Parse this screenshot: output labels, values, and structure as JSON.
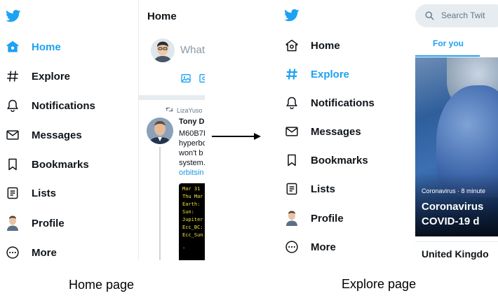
{
  "home_page": {
    "nav": {
      "items": [
        {
          "label": "Home",
          "icon": "home-icon",
          "active": true
        },
        {
          "label": "Explore",
          "icon": "hashtag-icon",
          "active": false
        },
        {
          "label": "Notifications",
          "icon": "bell-icon",
          "active": false
        },
        {
          "label": "Messages",
          "icon": "envelope-icon",
          "active": false
        },
        {
          "label": "Bookmarks",
          "icon": "bookmark-icon",
          "active": false
        },
        {
          "label": "Lists",
          "icon": "list-icon",
          "active": false
        },
        {
          "label": "Profile",
          "icon": "profile-avatar",
          "active": false
        },
        {
          "label": "More",
          "icon": "more-icon",
          "active": false
        }
      ]
    },
    "header_title": "Home",
    "compose_placeholder": "What",
    "retweet_by": "LizaYuso",
    "tweet": {
      "author": "Tony D",
      "lines": [
        "M60B7I",
        "hyperbo",
        "won't b",
        "system."
      ],
      "link": "orbitsin",
      "terminal_lines": [
        "Mar 31",
        "Thu Mar",
        "Earth:",
        "Sun:",
        "Jupiter",
        "Ecc_BC:",
        "Ecc_Sun",
        "."
      ]
    },
    "caption": "Home page"
  },
  "explore_page": {
    "nav": {
      "items": [
        {
          "label": "Home",
          "icon": "home-icon",
          "active": false
        },
        {
          "label": "Explore",
          "icon": "hashtag-icon",
          "active": true
        },
        {
          "label": "Notifications",
          "icon": "bell-icon",
          "active": false
        },
        {
          "label": "Messages",
          "icon": "envelope-icon",
          "active": false
        },
        {
          "label": "Bookmarks",
          "icon": "bookmark-icon",
          "active": false
        },
        {
          "label": "Lists",
          "icon": "list-icon",
          "active": false
        },
        {
          "label": "Profile",
          "icon": "profile-avatar",
          "active": false
        },
        {
          "label": "More",
          "icon": "more-icon",
          "active": false
        }
      ]
    },
    "search_placeholder": "Search Twit",
    "tab_label": "For you",
    "hero": {
      "meta": "Coronavirus · 8 minute",
      "title_lines": [
        "Coronavirus",
        "COVID-19 d"
      ]
    },
    "trend_title": "United Kingdo",
    "caption": "Explore page"
  },
  "colors": {
    "brand": "#1da1f2",
    "text": "#0f1419",
    "muted": "#657786",
    "border": "#e6ecf0"
  }
}
